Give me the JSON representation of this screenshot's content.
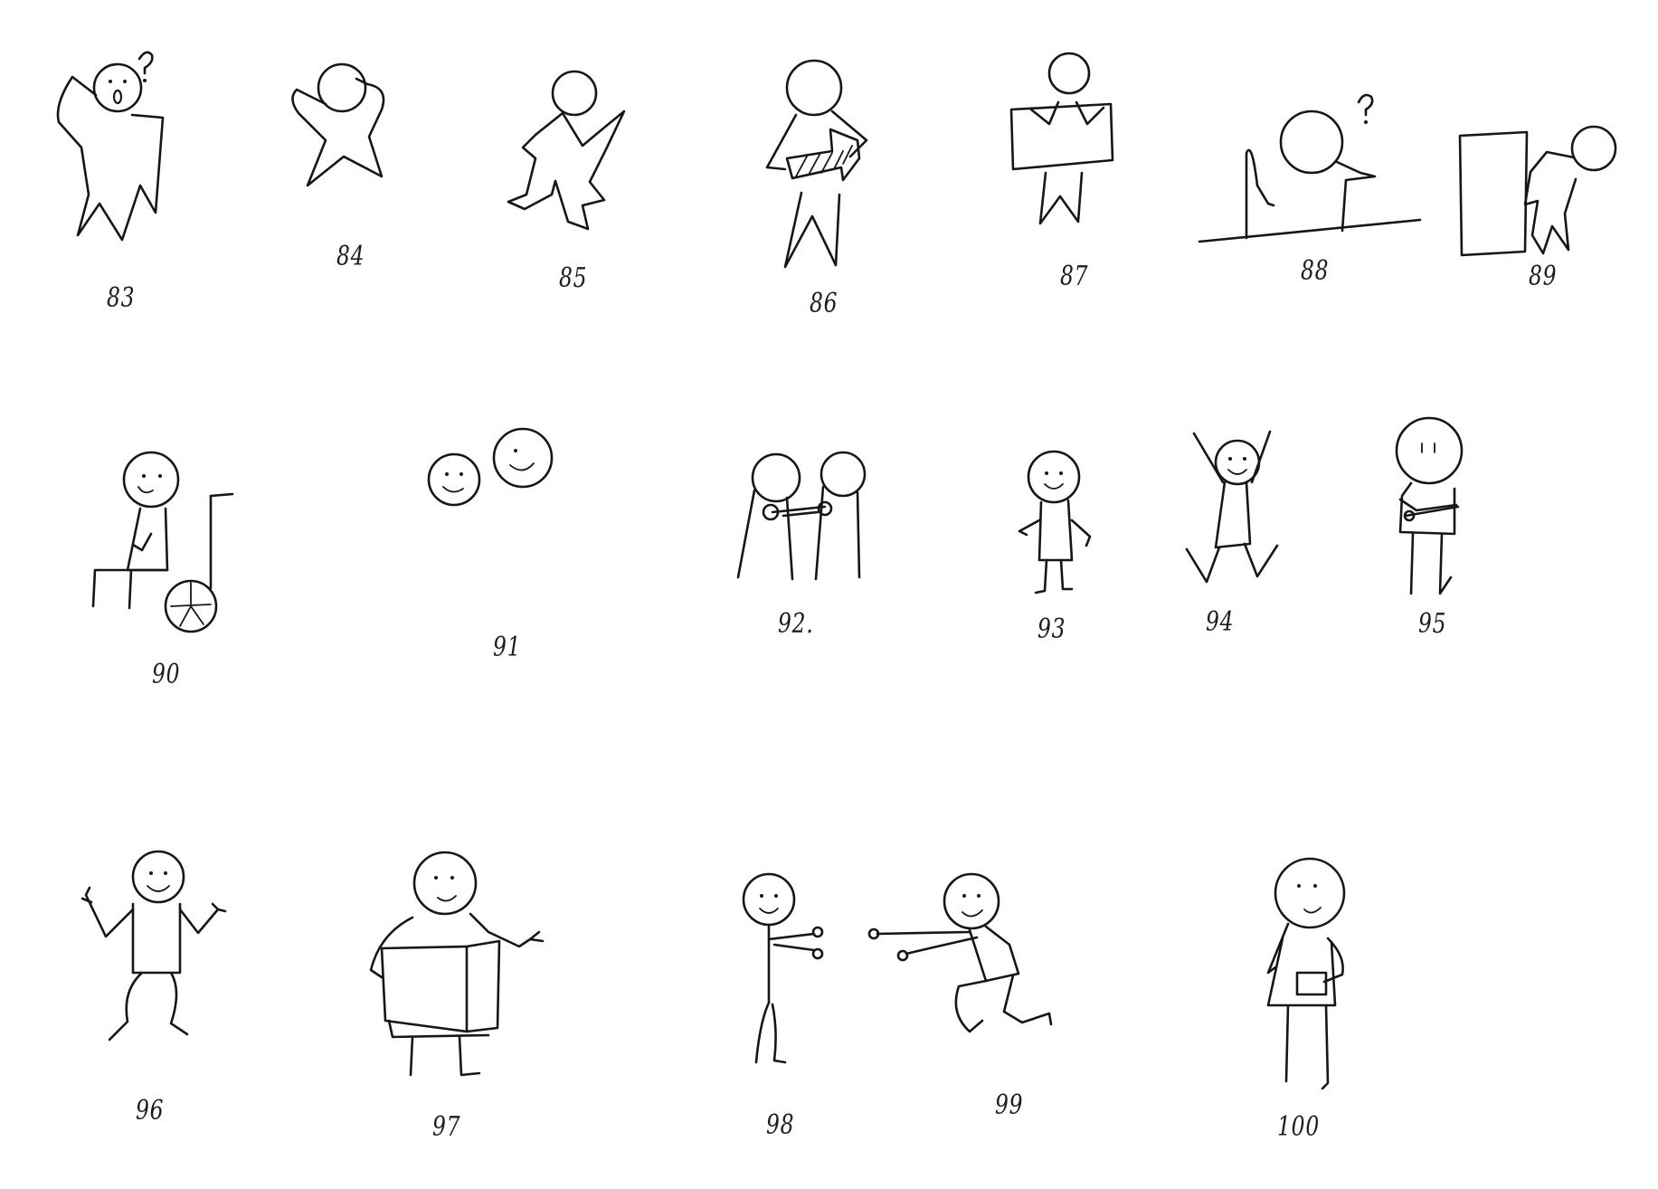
{
  "sheet": {
    "background": "#ffffff",
    "ink_color": "#161616"
  },
  "figures": [
    {
      "number": "83",
      "icon": "confused-person-icon"
    },
    {
      "number": "84",
      "icon": "scratching-head-icon"
    },
    {
      "number": "85",
      "icon": "jumping-person-icon"
    },
    {
      "number": "86",
      "icon": "holding-arrow-icon"
    },
    {
      "number": "87",
      "icon": "holding-sign-icon"
    },
    {
      "number": "88",
      "icon": "peeking-over-wall-icon"
    },
    {
      "number": "89",
      "icon": "person-at-door-icon"
    },
    {
      "number": "90",
      "icon": "wheelchair-user-icon"
    },
    {
      "number": "91",
      "icon": "two-people-together-icon"
    },
    {
      "number": "92.",
      "icon": "handshake-icon"
    },
    {
      "number": "93",
      "icon": "standing-person-icon"
    },
    {
      "number": "94",
      "icon": "cheering-person-icon"
    },
    {
      "number": "95",
      "icon": "arms-crossed-person-icon"
    },
    {
      "number": "96",
      "icon": "shrugging-person-icon"
    },
    {
      "number": "97",
      "icon": "reading-book-icon"
    },
    {
      "number": "98",
      "icon": "reaching-person-icon"
    },
    {
      "number": "99",
      "icon": "lunging-person-icon"
    },
    {
      "number": "100",
      "icon": "hand-in-pocket-icon"
    }
  ]
}
